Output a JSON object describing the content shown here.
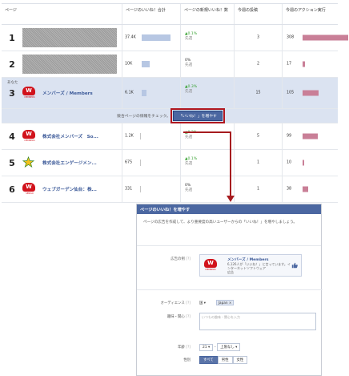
{
  "table": {
    "headers": [
      "ページ",
      "ページのいいね！合計",
      "ページの新規いいね！数",
      "今週の投稿",
      "今週のアクション実行"
    ],
    "rows": [
      {
        "rank": "1",
        "name": "",
        "total": "37.4K",
        "total_frac": 0.75,
        "delta": "▲0.1%",
        "delta_sub": "先週",
        "posts": "3",
        "actions": "308",
        "action_frac": 0.95,
        "logo": "masked"
      },
      {
        "rank": "2",
        "name": "",
        "total": "10K",
        "total_frac": 0.2,
        "delta": "0%",
        "delta_sub": "先週",
        "posts": "2",
        "actions": "17",
        "action_frac": 0.05,
        "logo": "masked"
      },
      {
        "rank": "3",
        "you_label": "あなた",
        "name": "メンバーズ / Members",
        "total": "6.1K",
        "total_frac": 0.13,
        "delta": "▲0.3%",
        "delta_sub": "先週",
        "posts": "15",
        "actions": "105",
        "action_frac": 0.33,
        "logo": "members"
      },
      {
        "rank": "4",
        "name": "株式会社メンバーズ　So...",
        "total": "1.2K",
        "total_frac": 0,
        "delta": "▲0.2%",
        "delta_sub": "先週",
        "posts": "5",
        "actions": "99",
        "action_frac": 0.31,
        "logo": "members"
      },
      {
        "rank": "5",
        "name": "株式会社エンゲージメン...",
        "total": "675",
        "total_frac": 0,
        "delta": "▲0.1%",
        "delta_sub": "先週",
        "posts": "1",
        "actions": "10",
        "action_frac": 0.03,
        "logo": "engagement"
      },
      {
        "rank": "6",
        "name": "ウェブガーデン仙台：株...",
        "total": "331",
        "total_frac": 0,
        "delta": "0%",
        "delta_sub": "先週",
        "posts": "1",
        "actions": "38",
        "action_frac": 0.12,
        "logo": "members-sendai"
      }
    ],
    "promo_text": "競合ページの情報をチェック。",
    "promo_button": "「いいね！」を増やす"
  },
  "dialog": {
    "title": "ページのいいね！を増やす",
    "description": "ページの広告を作成して、より重要度の高いユーザーからの「いいね！」を増やしましょう。",
    "ad_label": "広告の例",
    "ad_name": "メンバーズ / Members",
    "ad_text": "6,126人が「いいね！」と言っています。インターネットソフトウェア",
    "ad_sub": "広告",
    "audience_label": "オーディエンス",
    "country_select": "国 ▾",
    "country_chip": "Japan ×",
    "interest_label": "趣味・関心",
    "interest_placeholder": "いつもの趣味・関心を入力",
    "age_label": "年齢",
    "age_from": "21 ▾",
    "age_to": "上限なし ▾",
    "gender_label": "性別",
    "gender_options": [
      "すべて",
      "男性",
      "女性"
    ],
    "help_mark": "[?]"
  },
  "colors": {
    "brand": "#4b67a1",
    "bar_total": "#b7c7e3",
    "bar_action": "#c97f97",
    "positive": "#3aa335",
    "highlight": "#dbe3f1",
    "callout": "#a61b1f"
  }
}
